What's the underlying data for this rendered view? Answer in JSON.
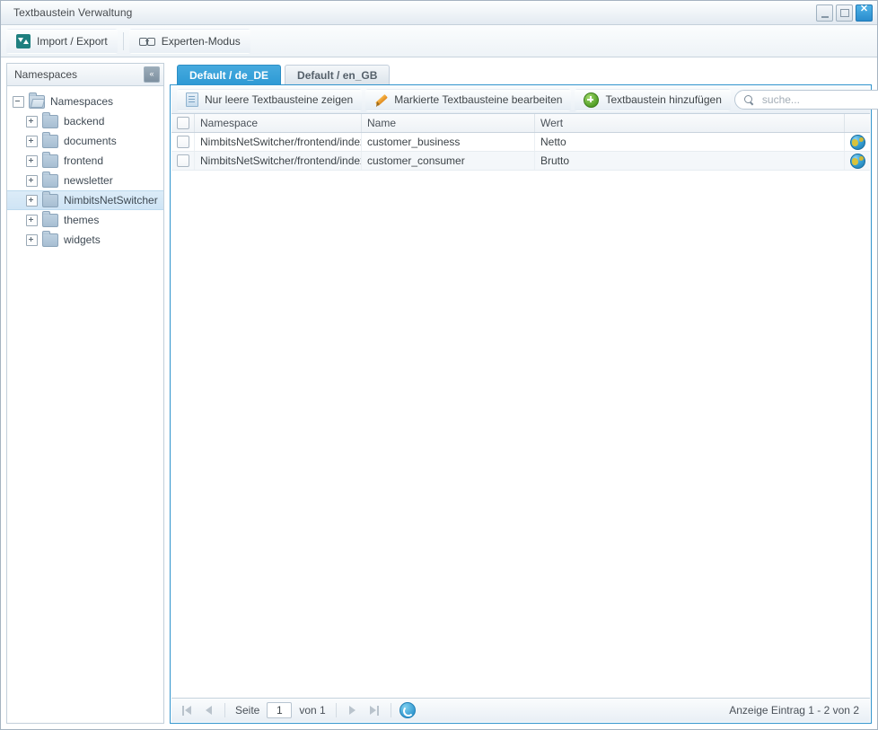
{
  "window": {
    "title": "Textbaustein Verwaltung",
    "minimize_label": "Minimieren",
    "maximize_label": "Maximieren",
    "close_label": "Schließen",
    "close_glyph": "✕"
  },
  "app_toolbar": {
    "buttons": [
      {
        "label": "Import / Export",
        "icon": "import-export-icon"
      },
      {
        "label": "Experten-Modus",
        "icon": "glasses-icon"
      }
    ]
  },
  "sidebar": {
    "title": "Namespaces",
    "collapse_glyph": "«",
    "tree": {
      "root": {
        "label": "Namespaces",
        "expanded": true
      },
      "items": [
        {
          "label": "backend",
          "selected": false
        },
        {
          "label": "documents",
          "selected": false
        },
        {
          "label": "frontend",
          "selected": false
        },
        {
          "label": "newsletter",
          "selected": false
        },
        {
          "label": "NimbitsNetSwitcher",
          "selected": true
        },
        {
          "label": "themes",
          "selected": false
        },
        {
          "label": "widgets",
          "selected": false
        }
      ]
    }
  },
  "main": {
    "tabs": [
      {
        "label": "Default / de_DE",
        "active": true
      },
      {
        "label": "Default / en_GB",
        "active": false
      }
    ],
    "grid_toolbar": {
      "buttons": [
        {
          "label": "Nur leere Textbausteine zeigen",
          "icon": "document-icon"
        },
        {
          "label": "Markierte Textbausteine bearbeiten",
          "icon": "pencil-icon"
        },
        {
          "label": "Textbaustein hinzufügen",
          "icon": "plus-circle-icon"
        }
      ],
      "search": {
        "placeholder": "suche...",
        "value": ""
      }
    },
    "grid": {
      "columns": [
        {
          "key": "check",
          "label": ""
        },
        {
          "key": "namespace",
          "label": "Namespace"
        },
        {
          "key": "name",
          "label": "Name"
        },
        {
          "key": "value",
          "label": "Wert"
        },
        {
          "key": "action",
          "label": ""
        }
      ],
      "rows": [
        {
          "namespace": "NimbitsNetSwitcher/frontend/index",
          "name": "customer_business",
          "value": "Netto",
          "action_icon": "globe-icon"
        },
        {
          "namespace": "NimbitsNetSwitcher/frontend/index",
          "name": "customer_consumer",
          "value": "Brutto",
          "action_icon": "globe-icon"
        }
      ]
    },
    "pager": {
      "first_label": "Erste Seite",
      "prev_label": "Vorherige Seite",
      "page_label": "Seite",
      "page_value": "1",
      "of_label": "von 1",
      "next_label": "Nächste Seite",
      "last_label": "Letzte Seite",
      "refresh_label": "Aktualisieren",
      "count_text": "Anzeige Eintrag 1 - 2 von 2"
    }
  },
  "colors": {
    "accent_blue": "#2f9ad6",
    "tab_active": "#46aade",
    "panel_border": "#2f93cd",
    "teal_icon": "#1e7f7f",
    "green_icon": "#4e9c24",
    "orange_pencil": "#e08a1e"
  }
}
